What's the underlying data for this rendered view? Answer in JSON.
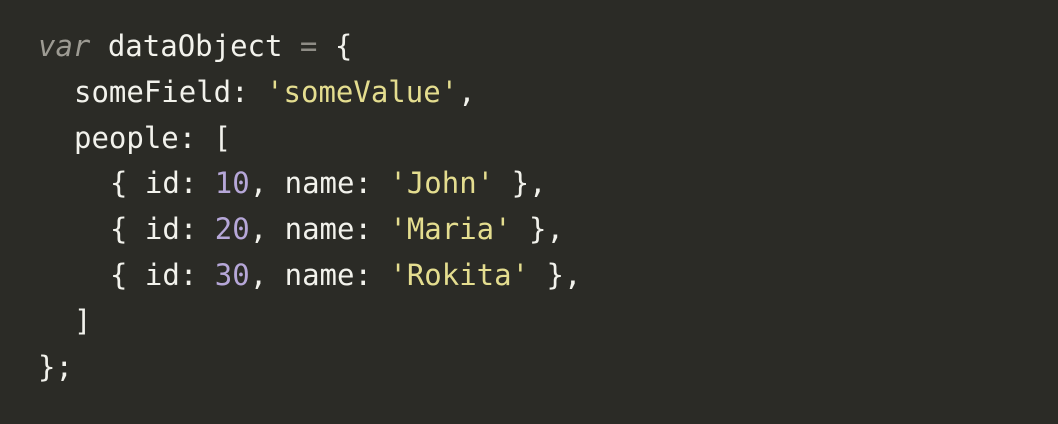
{
  "colors": {
    "background": "#2b2b26",
    "text": "#f2f2ec",
    "keyword": "#9d9b93",
    "operator": "#8f8d86",
    "string": "#e4dd8f",
    "number": "#b6a7d8"
  },
  "code": {
    "keyword_var": "var",
    "var_name": " dataObject ",
    "assign_op": "=",
    "open_brace": " {",
    "field_key": "someField: ",
    "field_value": "'someValue'",
    "field_comma": ",",
    "people_key": "people: [",
    "people": [
      {
        "open": "{ id: ",
        "id": "10",
        "mid": ", name: ",
        "name": "'John'",
        "close": " },"
      },
      {
        "open": "{ id: ",
        "id": "20",
        "mid": ", name: ",
        "name": "'Maria'",
        "close": " },"
      },
      {
        "open": "{ id: ",
        "id": "30",
        "mid": ", name: ",
        "name": "'Rokita'",
        "close": " },"
      }
    ],
    "close_bracket": "]",
    "close_brace": "};"
  }
}
